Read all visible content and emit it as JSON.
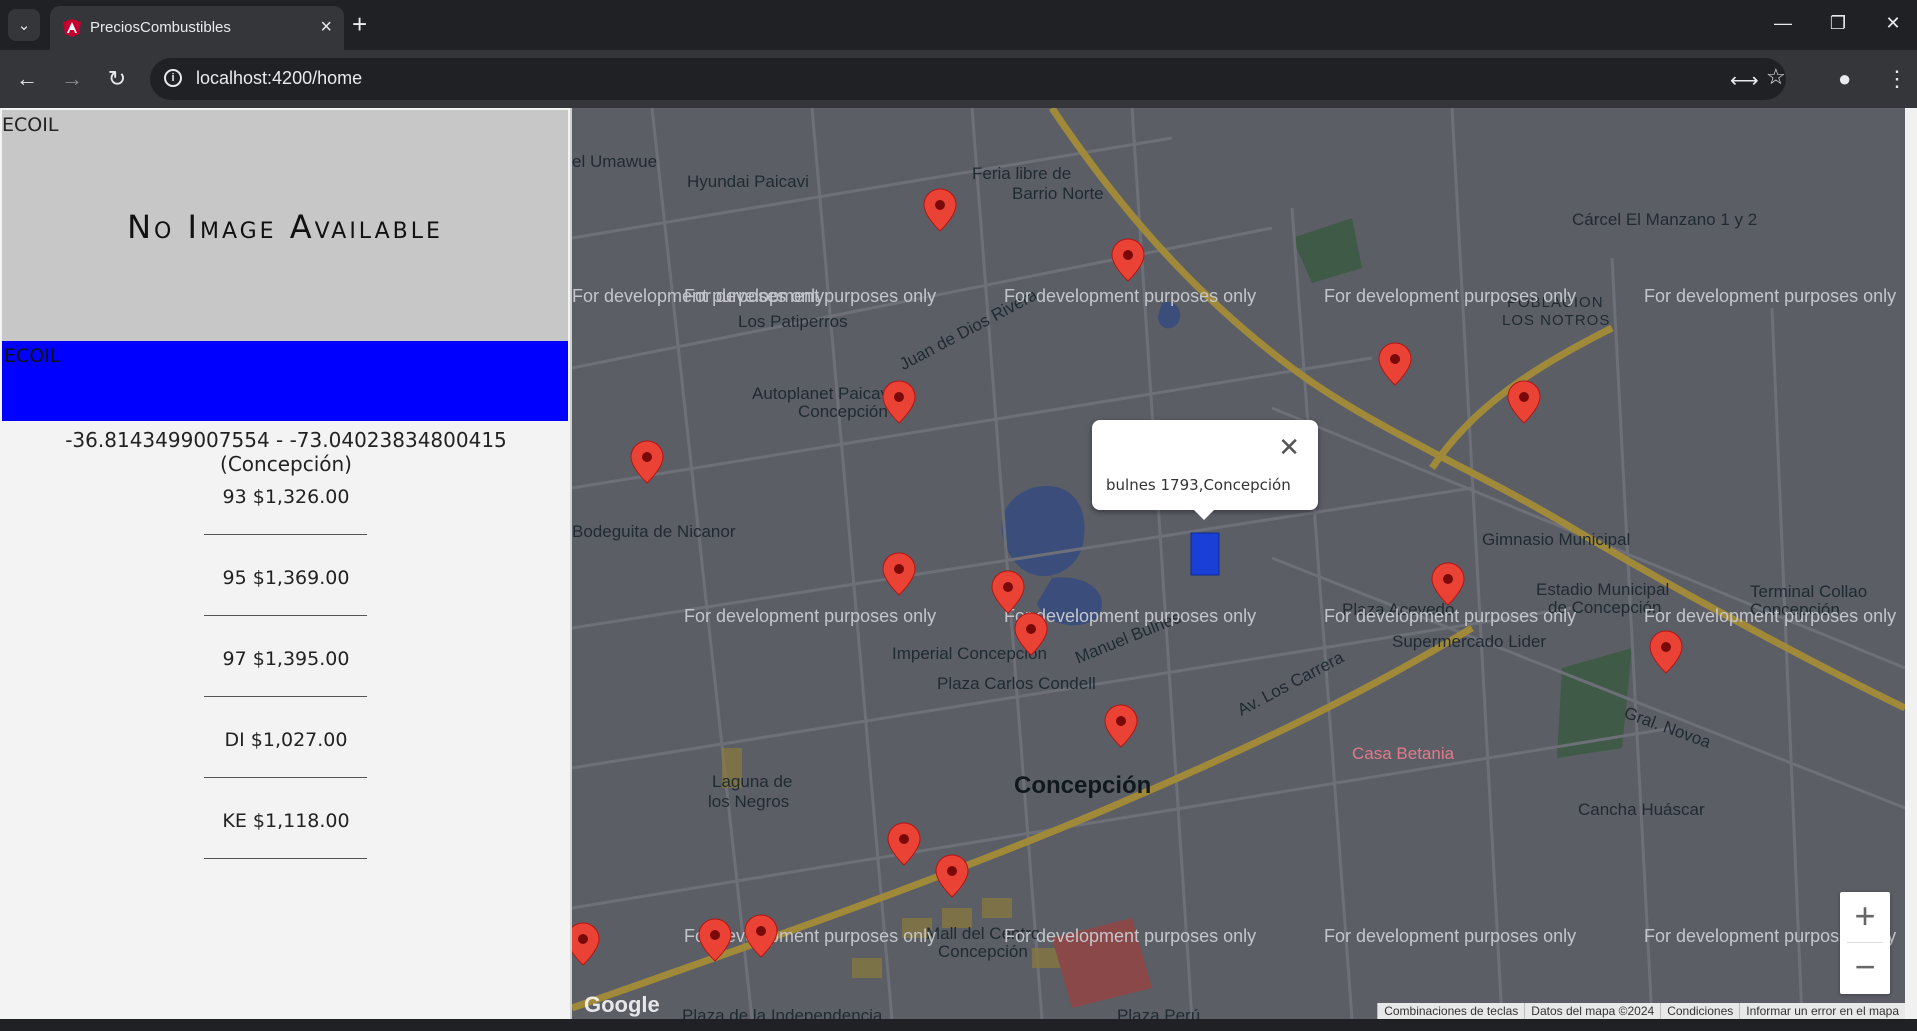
{
  "browser": {
    "tab_title": "PreciosCombustibles",
    "url": "localhost:4200/home"
  },
  "station": {
    "image_alt": "ECOIL",
    "no_image_text": "No Image Available",
    "brand_name": "ECOIL",
    "coordinates": "-36.8143499007554 - -73.04023834800415 (Concepción)",
    "prices": [
      {
        "label": "93 $1,326.00"
      },
      {
        "label": "95 $1,369.00"
      },
      {
        "label": "97 $1,395.00"
      },
      {
        "label": "DI $1,027.00"
      },
      {
        "label": "KE $1,118.00"
      }
    ],
    "brand_color": "#0000ff"
  },
  "map": {
    "popup_text": "bulnes 1793,Concepción",
    "watermark": "For development purposes only",
    "labels": {
      "feria": "Feria libre de",
      "barrio_norte": "Barrio Norte",
      "hyundai": "Hyundai Paicavi",
      "patiperros": "Los Patiperros",
      "autoplanet": "Autoplanet Paicavi",
      "concepcion_small": "Concepción",
      "poblacion": "POBLACION",
      "notros": "LOS NOTROS",
      "bodeguita": "Bodeguita de Nicanor",
      "imperial": "Imperial Concepción",
      "plaza_condell": "Plaza Carlos Condell",
      "concepcion_city": "Concepción",
      "laguna": "Laguna de",
      "negros": "los Negros",
      "plaza_acevedo": "Plaza Acevedo",
      "supermercado": "Supermercado Lider",
      "gimnasio": "Gimnasio Municipal",
      "estadio": "Estadio Municipal",
      "estadio2": "de Concepción",
      "terminal": "Terminal Collao",
      "terminal2": "Concepción",
      "casa_betania": "Casa Betania",
      "cancha": "Cancha Huáscar",
      "mall": "Mall del Centro",
      "mall2": "Concepción",
      "carcel": "Cárcel El Manzano 1 y 2",
      "umawue": "el Umawue",
      "juan_de_dios": "Juan de Dios Rivera",
      "manuel_bulnes": "Manuel Bulnes",
      "los_carrera": "Av. Los Carrera",
      "gral_novoa": "Gral. Novoa",
      "plaza_peru": "Plaza Perú",
      "plaza_indep": "Plaza de la Independencia"
    },
    "footer": {
      "shortcuts": "Combinaciones de teclas",
      "data": "Datos del mapa ©2024",
      "terms": "Condiciones",
      "report": "Informar un error en el mapa"
    },
    "pin_color": "#ea4335",
    "marker_color": "#1a3fd6"
  }
}
